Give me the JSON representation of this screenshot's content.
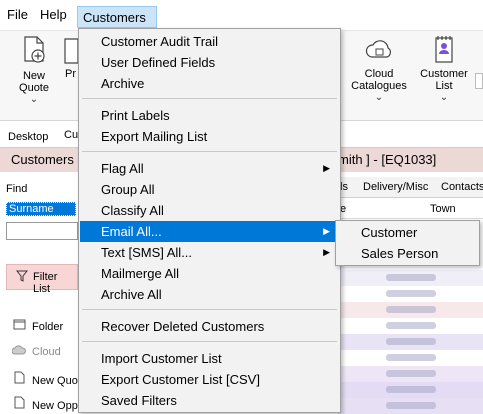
{
  "menubar": {
    "file": "File",
    "help": "Help",
    "customers": "Customers"
  },
  "ribbon": {
    "new_quote": "New Quote",
    "pr": "Pr",
    "cloud_catalogues": "Cloud Catalogues",
    "customer_list": "Customer List"
  },
  "tabs": {
    "desktop": "Desktop",
    "cu": "Cu",
    "ls": "ls",
    "delivery": "Delivery/Misc",
    "contacts": "Contacts"
  },
  "custbar": {
    "title": "Customers",
    "right": "mith ] - [EQ1033]"
  },
  "left": {
    "find": "Find",
    "surname": "Surname",
    "filter": "Filter List",
    "folder": "Folder",
    "cloud": "Cloud",
    "new_quote": "New Quo",
    "new_opp": "New Opp"
  },
  "grid": {
    "col_e": "e",
    "town": "Town"
  },
  "menu": {
    "items": [
      "Customer Audit Trail",
      "User Defined Fields",
      "Archive",
      "Print Labels",
      "Export Mailing List",
      "Flag All",
      "Group All",
      "Classify All",
      "Email All...",
      "Text [SMS] All...",
      "Mailmerge All",
      "Archive All",
      "Recover Deleted Customers",
      "Import Customer List",
      "Export Customer List [CSV]",
      "Saved Filters"
    ]
  },
  "submenu": {
    "items": [
      "Customer",
      "Sales Person"
    ]
  },
  "colors": {
    "highlight": "#0078d7",
    "menu_bg": "#f2f2f2",
    "header_bar": "#ecd9d7",
    "filter_btn": "#f8d6d6"
  }
}
